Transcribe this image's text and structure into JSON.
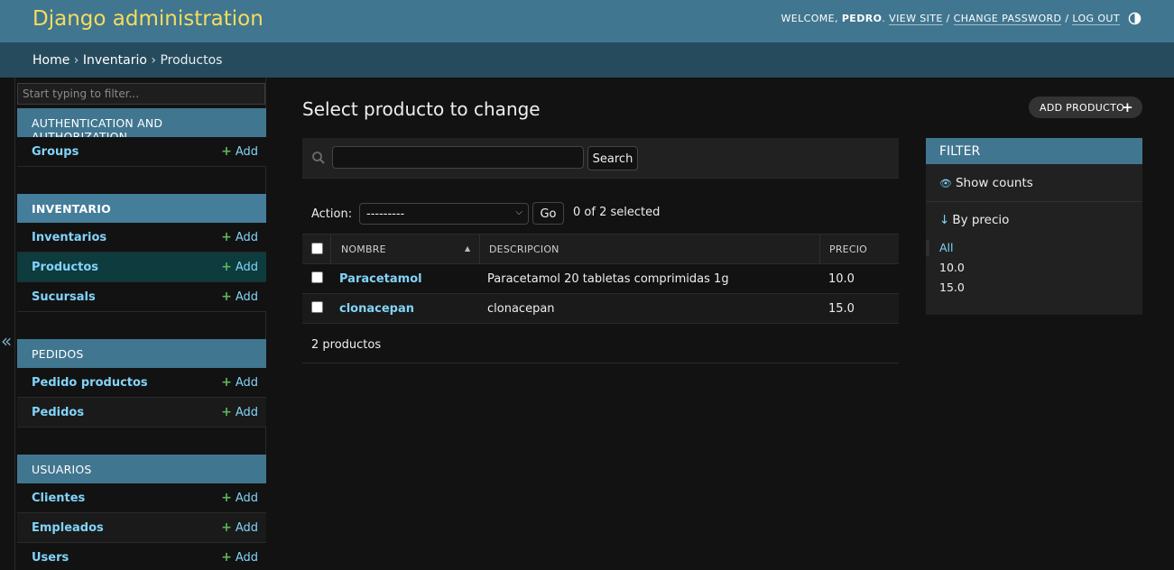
{
  "header": {
    "site_name": "Django administration",
    "welcome": "WELCOME,",
    "user_name": "PEDRO",
    "view_site": "VIEW SITE",
    "change_password": "CHANGE PASSWORD",
    "log_out": "LOG OUT",
    "separator": "/"
  },
  "breadcrumbs": {
    "home": "Home",
    "sep": "›",
    "app": "Inventario",
    "current": "Productos"
  },
  "sidebar": {
    "collapse_icon": "«",
    "filter_placeholder": "Start typing to filter...",
    "add_label": "Add",
    "modules": [
      {
        "caption": "AUTHENTICATION AND AUTHORIZATION",
        "models": [
          "Groups"
        ]
      },
      {
        "caption": "INVENTARIO",
        "models": [
          "Inventarios",
          "Productos",
          "Sucursals"
        ]
      },
      {
        "caption": "PEDIDOS",
        "models": [
          "Pedido productos",
          "Pedidos"
        ]
      },
      {
        "caption": "USUARIOS",
        "models": [
          "Clientes",
          "Empleados",
          "Users"
        ]
      }
    ]
  },
  "content": {
    "title": "Select producto to change",
    "add_button": "ADD PRODUCTO",
    "search_button": "Search",
    "action_label": "Action:",
    "action_selected": "---------",
    "go_button": "Go",
    "selection_count": "0 of 2 selected",
    "columns": [
      "NOMBRE",
      "DESCRIPCION",
      "PRECIO"
    ],
    "rows": [
      {
        "nombre": "Paracetamol",
        "descripcion": "Paracetamol 20 tabletas comprimidas 1g",
        "precio": "10.0"
      },
      {
        "nombre": "clonacepan",
        "descripcion": "clonacepan",
        "precio": "15.0"
      }
    ],
    "paginator": "2 productos"
  },
  "filter": {
    "title": "FILTER",
    "show_counts": "Show counts",
    "by_precio": "By precio",
    "options": [
      "All",
      "10.0",
      "15.0"
    ]
  },
  "colors": {
    "header_bg": "#417690",
    "breadcrumb_bg": "#264b5d",
    "site_name": "#f5dd5d",
    "link": "#81d4fa",
    "add_plus": "#5bb75b",
    "body_bg": "#121212"
  }
}
